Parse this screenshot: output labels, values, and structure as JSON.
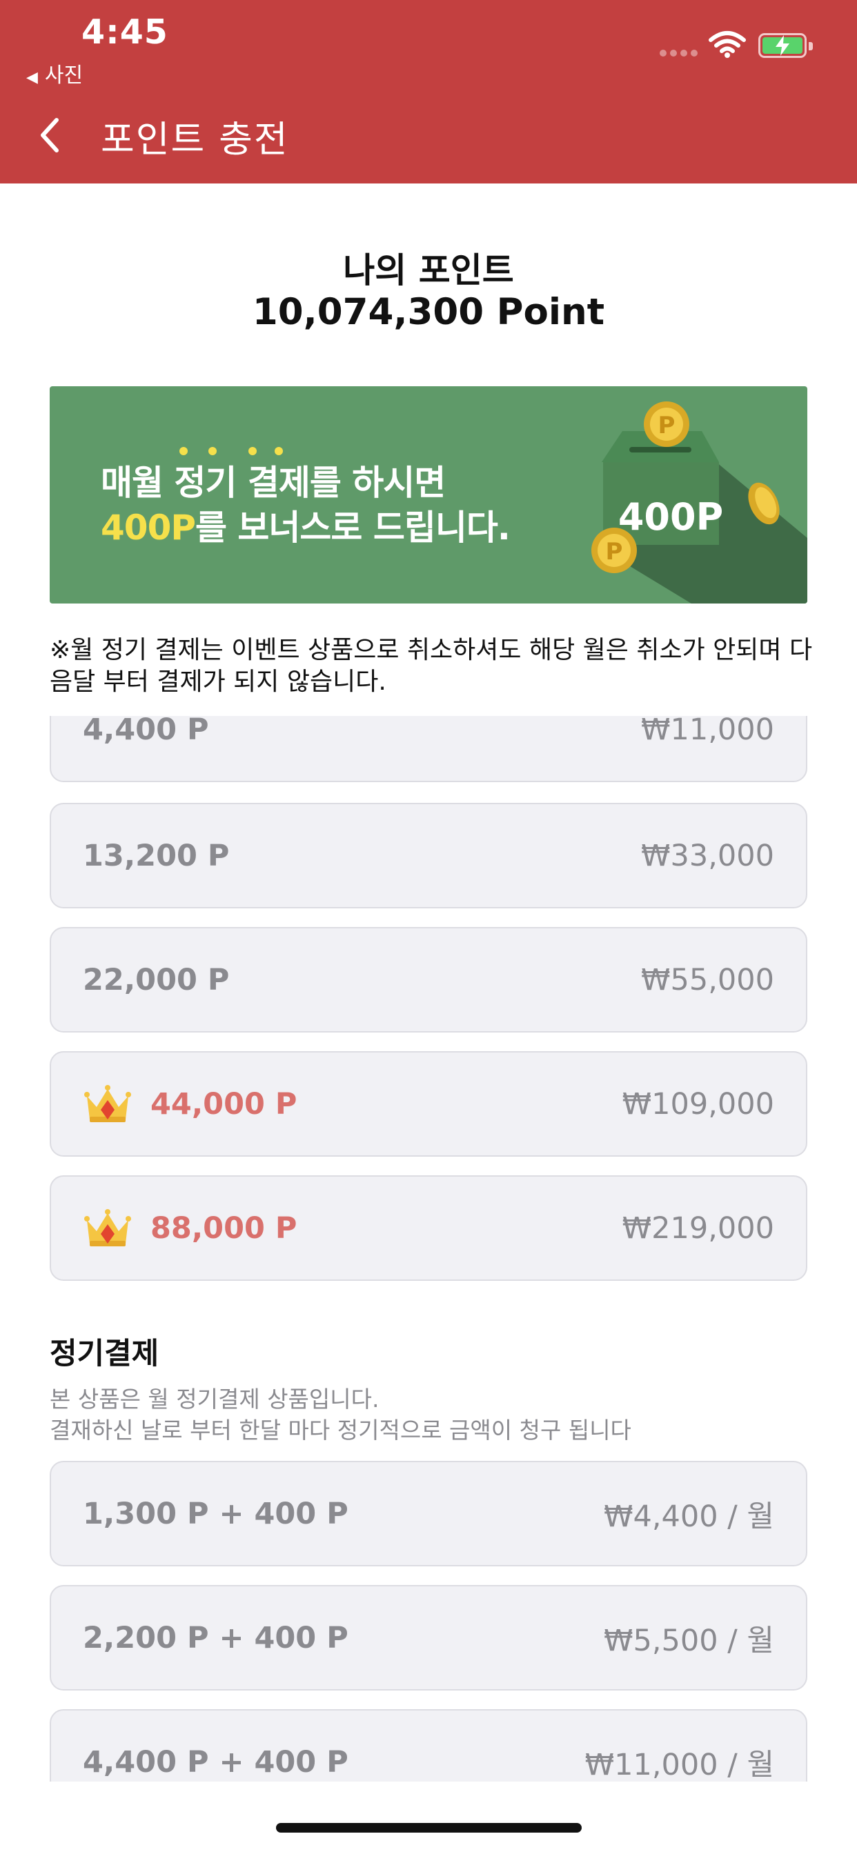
{
  "status_bar": {
    "time": "4:45",
    "back_app": "사진",
    "back_arrow": "◀"
  },
  "header": {
    "title": "포인트 충전",
    "back_icon": "chevron-left-icon"
  },
  "my_points": {
    "label": "나의 포인트",
    "value": "10,074,300 Point"
  },
  "banner": {
    "line1": "매월 정기 결제를 하시면",
    "line2_highlight": "400P",
    "line2_rest": "를 보너스로 드립니다.",
    "box_label": "400P",
    "colors": {
      "background": "#5f9a69",
      "highlight": "#f6e04b"
    }
  },
  "notice": "※월 정기 결제는 이벤트 상품으로 취소하셔도 해당 월은 취소가 안되며 다음달 부터 결제가 되지 않습니다.",
  "point_options": [
    {
      "points": "4,400 P",
      "price": "₩11,000",
      "premium": false
    },
    {
      "points": "13,200 P",
      "price": "₩33,000",
      "premium": false
    },
    {
      "points": "22,000 P",
      "price": "₩55,000",
      "premium": false
    },
    {
      "points": "44,000 P",
      "price": "₩109,000",
      "premium": true
    },
    {
      "points": "88,000 P",
      "price": "₩219,000",
      "premium": true
    }
  ],
  "subscription": {
    "title": "정기결제",
    "desc_line1": "본 상품은 월 정기결제 상품입니다.",
    "desc_line2": "결재하신 날로 부터 한달 마다 정기적으로 금액이 청구 됩니다",
    "options": [
      {
        "points": "1,300 P + 400 P",
        "price": "₩4,400 / 월"
      },
      {
        "points": "2,200 P + 400 P",
        "price": "₩5,500 / 월"
      },
      {
        "points": "4,400 P + 400 P",
        "price": "₩11,000 / 월"
      }
    ]
  },
  "colors": {
    "header": "#c34040",
    "option_bg": "#f1f1f5",
    "premium_text": "#d9706c",
    "muted_text": "#8a8a8f"
  }
}
